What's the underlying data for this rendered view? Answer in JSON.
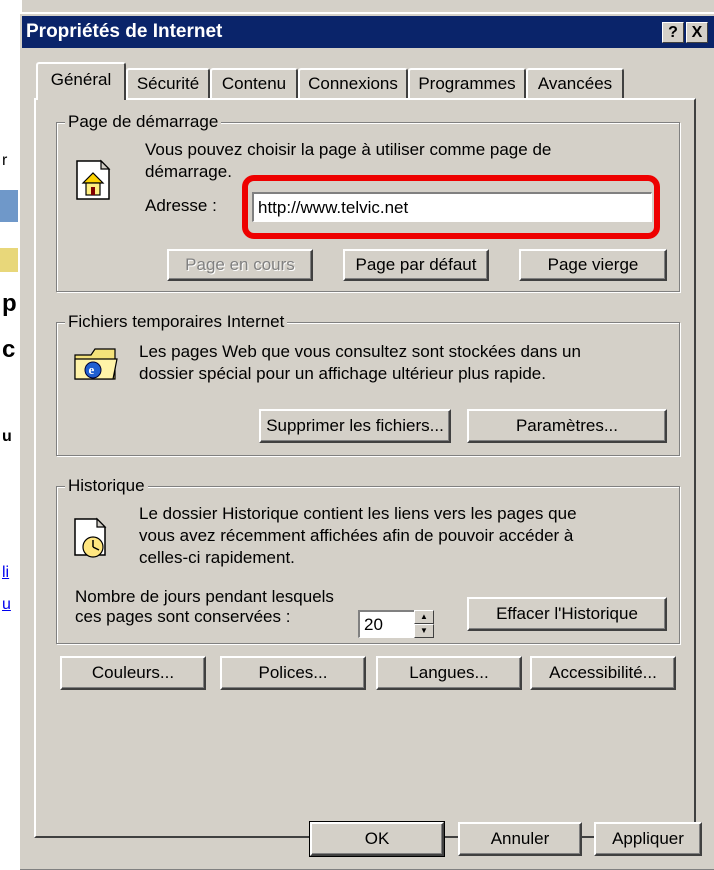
{
  "window": {
    "title": "Propriétés de Internet",
    "help_label": "?",
    "close_label": "X"
  },
  "tabs": [
    {
      "label": "Général",
      "active": true
    },
    {
      "label": "Sécurité"
    },
    {
      "label": "Contenu"
    },
    {
      "label": "Connexions"
    },
    {
      "label": "Programmes"
    },
    {
      "label": "Avancées"
    }
  ],
  "homepage": {
    "legend": "Page de démarrage",
    "description_line1": "Vous pouvez choisir la page à utiliser comme page de",
    "description_line2": "démarrage.",
    "address_label": "Adresse :",
    "address_value": "http://www.telvic.net",
    "btn_current": "Page en cours",
    "btn_default": "Page par défaut",
    "btn_blank": "Page vierge"
  },
  "temp_files": {
    "legend": "Fichiers temporaires Internet",
    "description_line1": "Les pages Web que vous consultez sont stockées dans un",
    "description_line2": "dossier spécial pour un affichage ultérieur plus rapide.",
    "btn_delete": "Supprimer les fichiers...",
    "btn_settings": "Paramètres..."
  },
  "history": {
    "legend": "Historique",
    "description_line1": "Le dossier Historique contient les liens vers les pages que",
    "description_line2": "vous avez récemment affichées afin de pouvoir accéder à",
    "description_line3": "celles-ci  rapidement.",
    "days_label_line1": "Nombre de jours pendant lesquels",
    "days_label_line2": "ces pages sont conservées :",
    "days_value": "20",
    "btn_clear": "Effacer l'Historique"
  },
  "bottom_buttons": {
    "colors": "Couleurs...",
    "fonts": "Polices...",
    "languages": "Langues...",
    "accessibility": "Accessibilité..."
  },
  "dialog_buttons": {
    "ok": "OK",
    "cancel": "Annuler",
    "apply": "Appliquer"
  },
  "background": {
    "frag1": "r",
    "frag2": "p",
    "frag3": "c",
    "frag4": "u",
    "frag5": "li",
    "frag6": "u"
  },
  "colors": {
    "titlebar": "#0a246a",
    "face": "#d4d0c8",
    "highlight_box": "#ee0000"
  }
}
